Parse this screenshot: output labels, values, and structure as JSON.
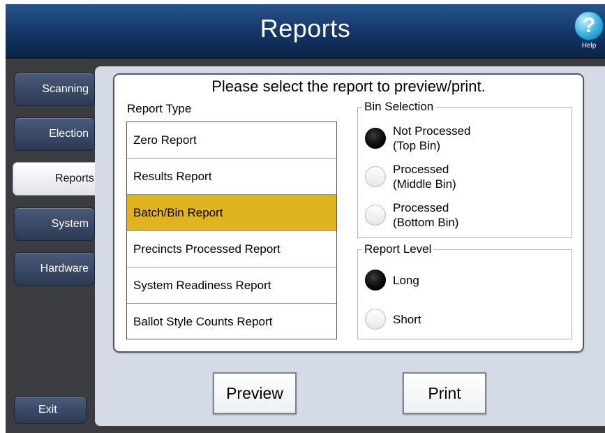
{
  "window": {
    "title": "Reports"
  },
  "help": {
    "label": "Help",
    "glyph": "?"
  },
  "sidebar": {
    "items": [
      {
        "label": "Scanning"
      },
      {
        "label": "Election"
      },
      {
        "label": "Reports",
        "active": true
      },
      {
        "label": "System"
      },
      {
        "label": "Hardware"
      }
    ],
    "exit_label": "Exit"
  },
  "main": {
    "prompt": "Please select the report to preview/print.",
    "report_type_label": "Report Type",
    "reports": [
      {
        "label": "Zero Report"
      },
      {
        "label": "Results Report"
      },
      {
        "label": "Batch/Bin Report",
        "selected": true
      },
      {
        "label": "Precincts Processed Report"
      },
      {
        "label": "System Readiness Report"
      },
      {
        "label": "Ballot Style Counts Report"
      }
    ],
    "bin_selection": {
      "title": "Bin Selection",
      "options": [
        {
          "line1": "Not Processed",
          "line2": "(Top Bin)",
          "selected": true
        },
        {
          "line1": "Processed",
          "line2": "(Middle Bin)",
          "selected": false
        },
        {
          "line1": "Processed",
          "line2": "(Bottom Bin)",
          "selected": false
        }
      ]
    },
    "report_level": {
      "title": "Report Level",
      "options": [
        {
          "label": "Long",
          "selected": true
        },
        {
          "label": "Short",
          "selected": false
        }
      ]
    }
  },
  "actions": {
    "preview_label": "Preview",
    "print_label": "Print"
  },
  "colors": {
    "selection_highlight": "#e0b321",
    "titlebar": "#173a6c",
    "content_background": "#d5dbe6",
    "sidebar_button": "#3b4a66"
  }
}
